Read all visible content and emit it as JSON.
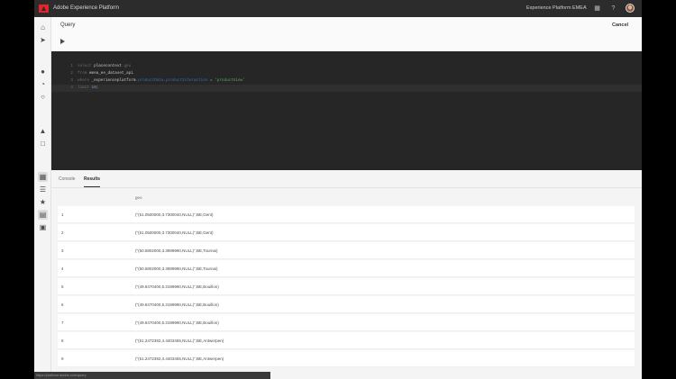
{
  "shell": {
    "title": "Adobe Experience Platform",
    "org": "Experience Platform EMEA",
    "icons": [
      "adobe-logo-icon",
      "apps-grid-icon",
      "help-icon",
      "avatar"
    ]
  },
  "rail": {
    "icons": [
      "home-icon",
      "share-icon",
      "profile-icon",
      "segments-icon",
      "identity-icon",
      "user-icon",
      "policy-icon",
      "workflow-icon",
      "datasets-icon",
      "sources-icon",
      "queries-icon",
      "monitoring-icon"
    ]
  },
  "query": {
    "title": "Query",
    "cancel_label": "Cancel",
    "run_icon": "play-icon"
  },
  "editor": {
    "lines": [
      {
        "num": "1",
        "tokens": [
          {
            "t": "kw",
            "v": "select "
          },
          {
            "t": "id",
            "v": "placecontext"
          },
          {
            "t": "kw",
            "v": ".geo"
          }
        ]
      },
      {
        "num": "2",
        "tokens": [
          {
            "t": "kw",
            "v": "from "
          },
          {
            "t": "id",
            "v": "emea_ee_dataset_api"
          }
        ]
      },
      {
        "num": "3",
        "tokens": [
          {
            "t": "kw",
            "v": "where "
          },
          {
            "t": "id",
            "v": "_experienceplatform"
          },
          {
            "t": "prop",
            "v": ".productData.productInteraction"
          },
          {
            "t": "op",
            "v": " = "
          },
          {
            "t": "str",
            "v": "'productView'"
          }
        ]
      },
      {
        "num": "4",
        "tokens": [
          {
            "t": "kw",
            "v": "limit "
          },
          {
            "t": "num",
            "v": "10"
          },
          {
            "t": "op",
            "v": ";"
          }
        ]
      }
    ]
  },
  "results": {
    "tabs": [
      "Console",
      "Results"
    ],
    "selected_tab": "Results",
    "column": "geo",
    "rows": [
      {
        "idx": "1",
        "val": "(\"(51.0500000,3.7300040,NULL)\",BE,Gent)"
      },
      {
        "idx": "2",
        "val": "(\"(51.0500000,3.7300040,NULL)\",BE,Gent)"
      },
      {
        "idx": "3",
        "val": "(\"(50.5802000,3.3999990,NULL)\",BE,Tournai)"
      },
      {
        "idx": "4",
        "val": "(\"(50.5802000,3.3999990,NULL)\",BE,Tournai)"
      },
      {
        "idx": "5",
        "val": "(\"(49.8470400,5.3199990,NULL)\",BE,Bouillon)"
      },
      {
        "idx": "6",
        "val": "(\"(49.8470400,5.3199990,NULL)\",BE,Bouillon)"
      },
      {
        "idx": "7",
        "val": "(\"(49.8470400,5.3199990,NULL)\",BE,Bouillon)"
      },
      {
        "idx": "8",
        "val": "(\"(51.2472392,4.4403455,NULL)\",BE,Antwerpen)"
      },
      {
        "idx": "9",
        "val": "(\"(51.2472392,4.4403455,NULL)\",BE,Antwerpen)"
      }
    ]
  },
  "status_url": "https://platform.adobe.com/query"
}
